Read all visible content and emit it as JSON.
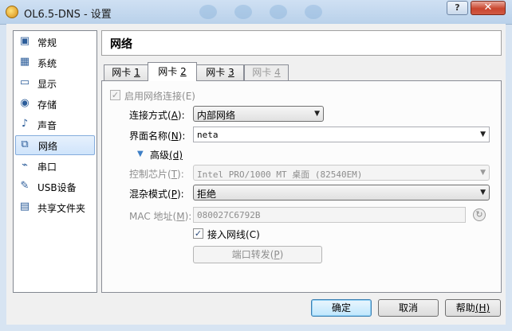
{
  "window": {
    "title": "OL6.5-DNS - 设置",
    "help_label": "?",
    "close_label": "✕"
  },
  "sidebar": {
    "items": [
      {
        "label": "常规",
        "icon": "general-icon",
        "glyph": "▣"
      },
      {
        "label": "系统",
        "icon": "system-icon",
        "glyph": "▦"
      },
      {
        "label": "显示",
        "icon": "display-icon",
        "glyph": "▭"
      },
      {
        "label": "存储",
        "icon": "storage-icon",
        "glyph": "◉"
      },
      {
        "label": "声音",
        "icon": "audio-icon",
        "glyph": "♪"
      },
      {
        "label": "网络",
        "icon": "network-icon",
        "glyph": "⧉"
      },
      {
        "label": "串口",
        "icon": "serial-port-icon",
        "glyph": "⌁"
      },
      {
        "label": "USB设备",
        "icon": "usb-icon",
        "glyph": "✎"
      },
      {
        "label": "共享文件夹",
        "icon": "shared-folder-icon",
        "glyph": "▤"
      }
    ],
    "selected_index": 5
  },
  "header": {
    "title": "网络"
  },
  "tabs": [
    {
      "label": "网卡 ",
      "key": "1"
    },
    {
      "label": "网卡 ",
      "key": "2"
    },
    {
      "label": "网卡 ",
      "key": "3"
    },
    {
      "label": "网卡 ",
      "key": "4"
    }
  ],
  "form": {
    "enable_label": "启用网络连接",
    "enable_key": "(E)",
    "attached_label": "连接方式(",
    "attached_key": "A",
    "attached_suffix": "):",
    "attached_value": "内部网络",
    "name_label": "界面名称(",
    "name_key": "N",
    "name_suffix": "):",
    "name_value": "neta",
    "advanced_label": "高级",
    "advanced_key": "(d)",
    "adapter_type_label": "控制芯片(",
    "adapter_type_key": "T",
    "adapter_type_suffix": "):",
    "adapter_type_value": "Intel PRO/1000 MT 桌面 (82540EM)",
    "promisc_label": "混杂模式(",
    "promisc_key": "P",
    "promisc_suffix": "):",
    "promisc_value": "拒绝",
    "mac_label": "MAC 地址(",
    "mac_key": "M",
    "mac_suffix": "):",
    "mac_value": "080027C6792B",
    "cable_label": "接入网线",
    "cable_key": "(C)",
    "port_forward_label": "端口转发(",
    "port_forward_key": "P",
    "port_forward_suffix": ")"
  },
  "buttons": {
    "ok": "确定",
    "cancel": "取消",
    "help": "帮助",
    "help_key": "(H)"
  }
}
